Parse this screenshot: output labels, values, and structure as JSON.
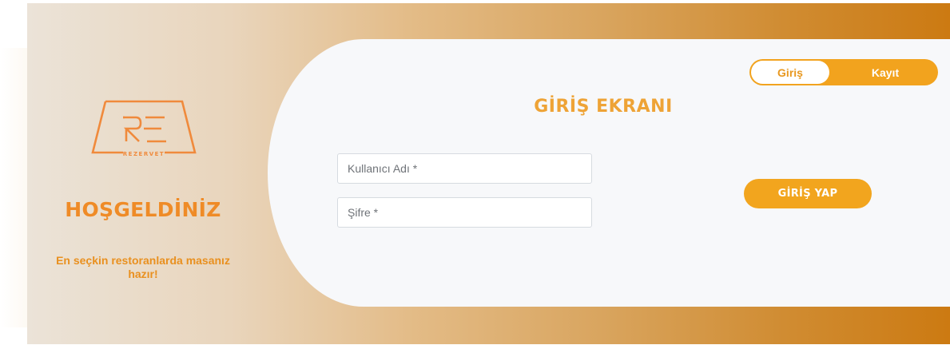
{
  "brand": {
    "logo_text": "REZERVET",
    "logo_mark": "RE",
    "accent": "#ef8b27"
  },
  "welcome": {
    "title": "HOŞGELDİNİZ",
    "subtitle": "En seçkin restoranlarda masanız hazır!"
  },
  "toggle": {
    "active_label": "Giriş",
    "inactive_label": "Kayıt"
  },
  "form": {
    "title": "GİRİŞ EKRANI",
    "username_placeholder": "Kullanıcı Adı *",
    "username_value": "",
    "password_placeholder": "Şifre *",
    "password_value": "",
    "submit_label": "GİRİŞ YAP"
  },
  "colors": {
    "orange": "#f2a31e",
    "card_bg": "#f7f8fa"
  }
}
